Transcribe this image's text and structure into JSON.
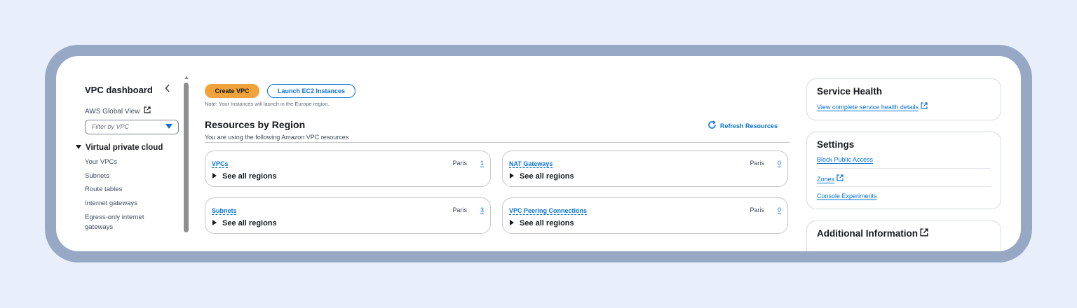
{
  "sidebar": {
    "title": "VPC dashboard",
    "global_view": "AWS Global View",
    "filter_placeholder": "Filter by VPC",
    "section": "Virtual private cloud",
    "items": [
      {
        "label": "Your VPCs"
      },
      {
        "label": "Subnets"
      },
      {
        "label": "Route tables"
      },
      {
        "label": "Internet gateways"
      },
      {
        "label": "Egress-only internet gateways"
      }
    ]
  },
  "main": {
    "create_vpc": "Create VPC",
    "launch_ec2": "Launch EC2 Instances",
    "note": "Note: Your Instances will launch in the Europe region.",
    "resources_title": "Resources by Region",
    "resources_sub": "You are using the following Amazon VPC resources",
    "refresh": "Refresh Resources",
    "cards": [
      {
        "name": "VPCs",
        "region": "Paris",
        "count": "1",
        "expand": "See all regions"
      },
      {
        "name": "NAT Gateways",
        "region": "Paris",
        "count": "0",
        "expand": "See all regions"
      },
      {
        "name": "Subnets",
        "region": "Paris",
        "count": "3",
        "expand": "See all regions"
      },
      {
        "name": "VPC Peering Connections",
        "region": "Paris",
        "count": "0",
        "expand": "See all regions"
      }
    ]
  },
  "right": {
    "service_health": {
      "title": "Service Health",
      "link": "View complete service health details"
    },
    "settings": {
      "title": "Settings",
      "links": [
        "Block Public Access",
        "Zones",
        "Console Experiments"
      ]
    },
    "additional": {
      "title": "Additional Information"
    }
  },
  "colors": {
    "accent": "#0972d3",
    "primary_button": "#f0a33a",
    "frame": "#97a8c5",
    "background": "#e8effb"
  },
  "icons": [
    "chevron-left-icon",
    "external-link-icon",
    "caret-down-icon",
    "refresh-icon",
    "triangle-right-icon"
  ]
}
